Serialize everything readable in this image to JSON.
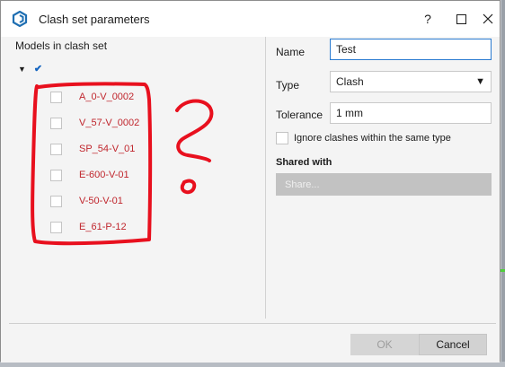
{
  "window": {
    "title": "Clash set parameters",
    "help_glyph": "?",
    "maximize_glyph": "☐",
    "close_glyph": "✕"
  },
  "models": {
    "header": "Models in clash set",
    "root_check": "✔",
    "tree_arrow": "▼",
    "items": [
      {
        "label": "A_0-V_0002",
        "checked": false
      },
      {
        "label": "V_57-V_0002",
        "checked": false
      },
      {
        "label": "SP_54-V_01",
        "checked": false
      },
      {
        "label": "E-600-V-01",
        "checked": false
      },
      {
        "label": "V-50-V-01",
        "checked": false
      },
      {
        "label": "E_61-P-12",
        "checked": false
      }
    ]
  },
  "form": {
    "name_label": "Name",
    "name_value": "Test",
    "type_label": "Type",
    "type_value": "Clash",
    "tolerance_label": "Tolerance",
    "tolerance_value": "1 mm",
    "ignore_label": "Ignore clashes within the same type",
    "ignore_checked": false,
    "shared_label": "Shared with",
    "share_button": "Share..."
  },
  "footer": {
    "ok_label": "OK",
    "cancel_label": "Cancel"
  },
  "colors": {
    "accent": "#2a7bd1",
    "model_text": "#c0262d",
    "annotation": "#e8101e",
    "disabled_button": "#c2c2c2"
  }
}
